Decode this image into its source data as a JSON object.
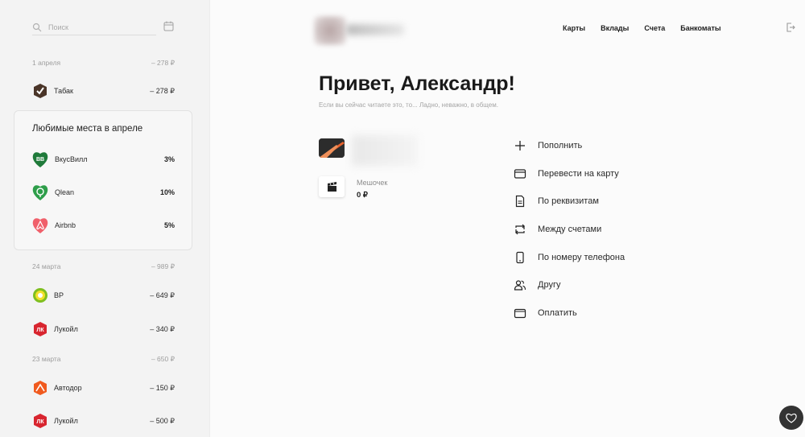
{
  "sidebar": {
    "search_placeholder": "Поиск",
    "groups": [
      {
        "date": "1 апреля",
        "total": "– 278 ₽"
      },
      {
        "date": "24 марта",
        "total": "– 989 ₽"
      },
      {
        "date": "23 марта",
        "total": "– 650 ₽"
      }
    ],
    "transactions": [
      {
        "name": "Табак",
        "amount": "– 278 ₽"
      },
      {
        "name": "BP",
        "amount": "– 649 ₽"
      },
      {
        "name": "Лукойл",
        "amount": "– 340 ₽"
      },
      {
        "name": "Автодор",
        "amount": "– 150 ₽"
      },
      {
        "name": "Лукойл",
        "amount": "– 500 ₽"
      }
    ],
    "favorites": {
      "title": "Любимые места в апреле",
      "items": [
        {
          "name": "ВкусВилл",
          "percent": "3%"
        },
        {
          "name": "Qlean",
          "percent": "10%"
        },
        {
          "name": "Airbnb",
          "percent": "5%"
        }
      ]
    }
  },
  "nav": {
    "cards": "Карты",
    "deposits": "Вклады",
    "accounts": "Счета",
    "atms": "Банкоматы"
  },
  "main": {
    "greeting": "Привет, Александр!",
    "subtitle": "Если вы сейчас читаете это, то... Ладно, неважно, в общем.",
    "pouch_name": "Мешочек",
    "pouch_balance": "0 ₽"
  },
  "actions": [
    {
      "label": "Пополнить",
      "icon": "plus-icon"
    },
    {
      "label": "Перевести на карту",
      "icon": "card-icon"
    },
    {
      "label": "По реквизитам",
      "icon": "document-icon"
    },
    {
      "label": "Между счетами",
      "icon": "swap-icon"
    },
    {
      "label": "По номеру телефона",
      "icon": "phone-icon"
    },
    {
      "label": "Другу",
      "icon": "friends-icon"
    },
    {
      "label": "Оплатить",
      "icon": "wallet-icon"
    }
  ],
  "colors": {
    "vkusvill": "#1f7a3a",
    "qlean": "#2e9e4a",
    "airbnb": "#f0606b",
    "lukoil": "#d8252f",
    "avtodor": "#f05a1e",
    "bp": "#7fbf1f",
    "tabak": "#4a3528"
  }
}
